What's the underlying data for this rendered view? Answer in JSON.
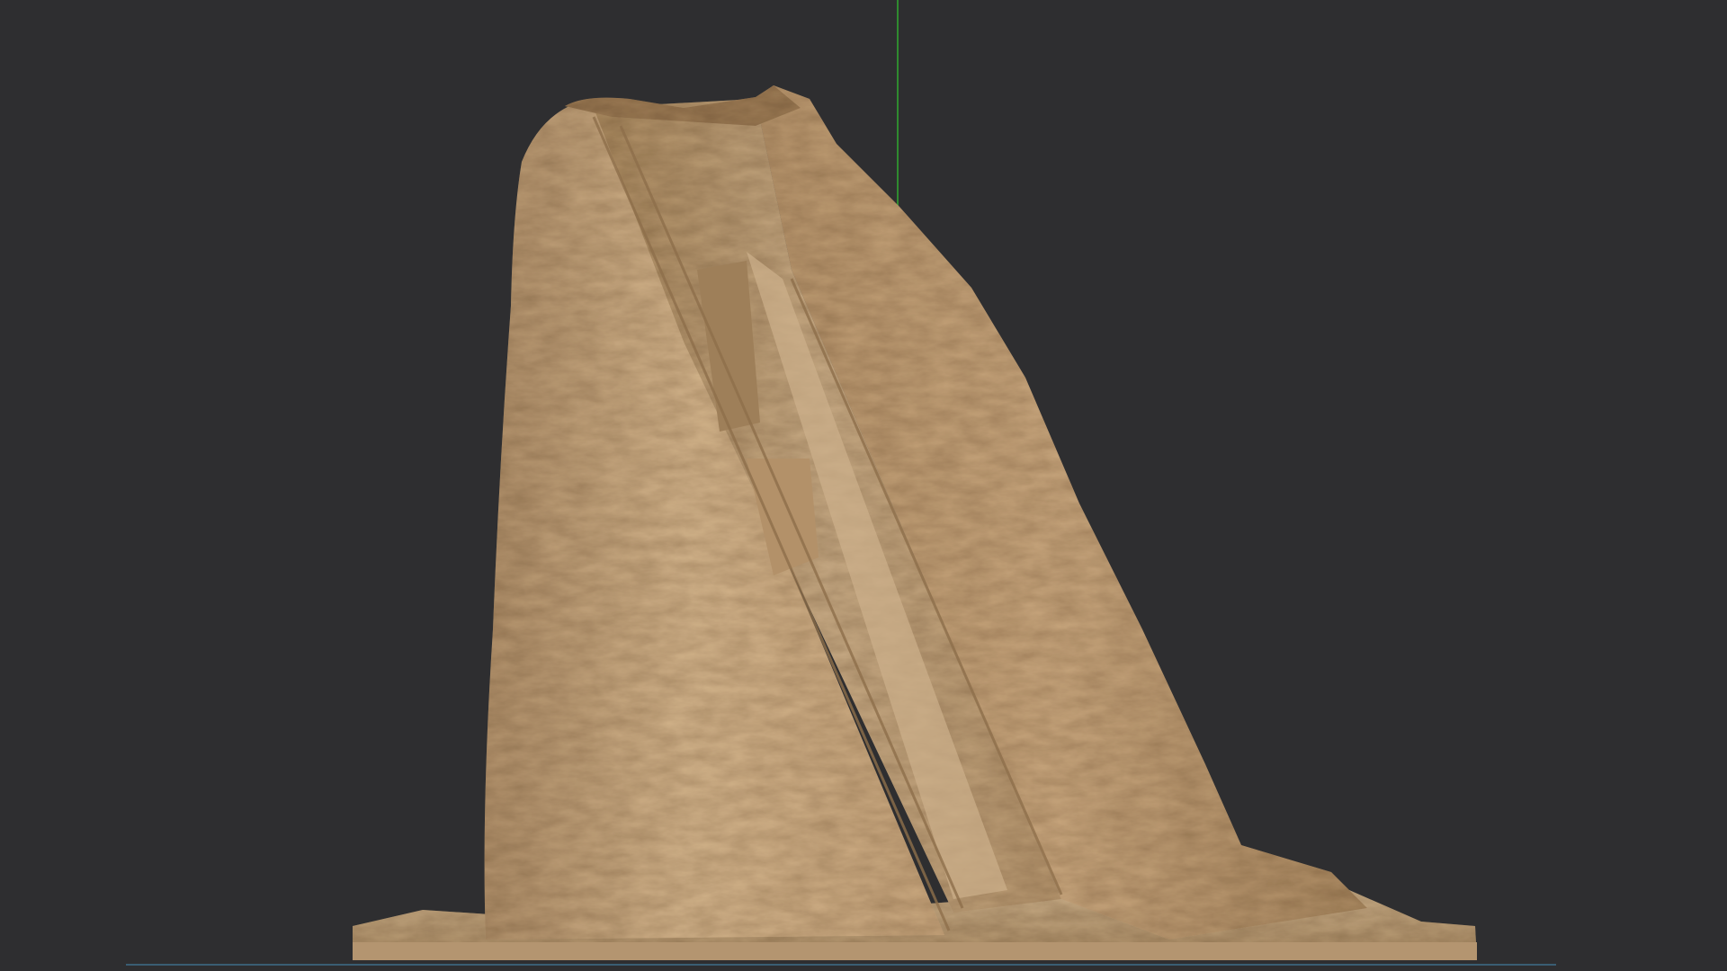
{
  "viewport": {
    "background": "#2e2e30",
    "axis_y_color": "#2f8a2f",
    "axis_x_color": "#3a5d73"
  },
  "model": {
    "name": "sculpted-rock-mesh",
    "material_color": "#c4a47c",
    "shadow_color": "#8f7352",
    "highlight_color": "#e2c9a3"
  }
}
